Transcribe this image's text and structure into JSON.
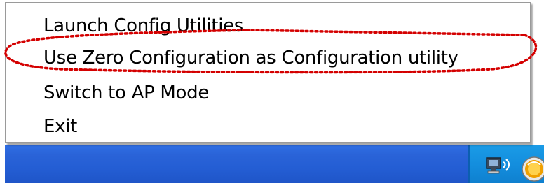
{
  "context_menu": {
    "items": [
      {
        "label": "Launch Config Utilities"
      },
      {
        "label": "Use Zero Configuration as Configuration utility"
      },
      {
        "label": "Switch to AP Mode"
      },
      {
        "label": "Exit"
      }
    ]
  },
  "annotation": {
    "highlighted_item": "Use Zero Configuration as Configuration utility",
    "color": "#d40000"
  },
  "taskbar": {
    "color": "#245ed4",
    "tray_color": "#138ddd",
    "tray_icons": [
      "wireless-network-icon",
      "wireless-utility-icon"
    ]
  }
}
